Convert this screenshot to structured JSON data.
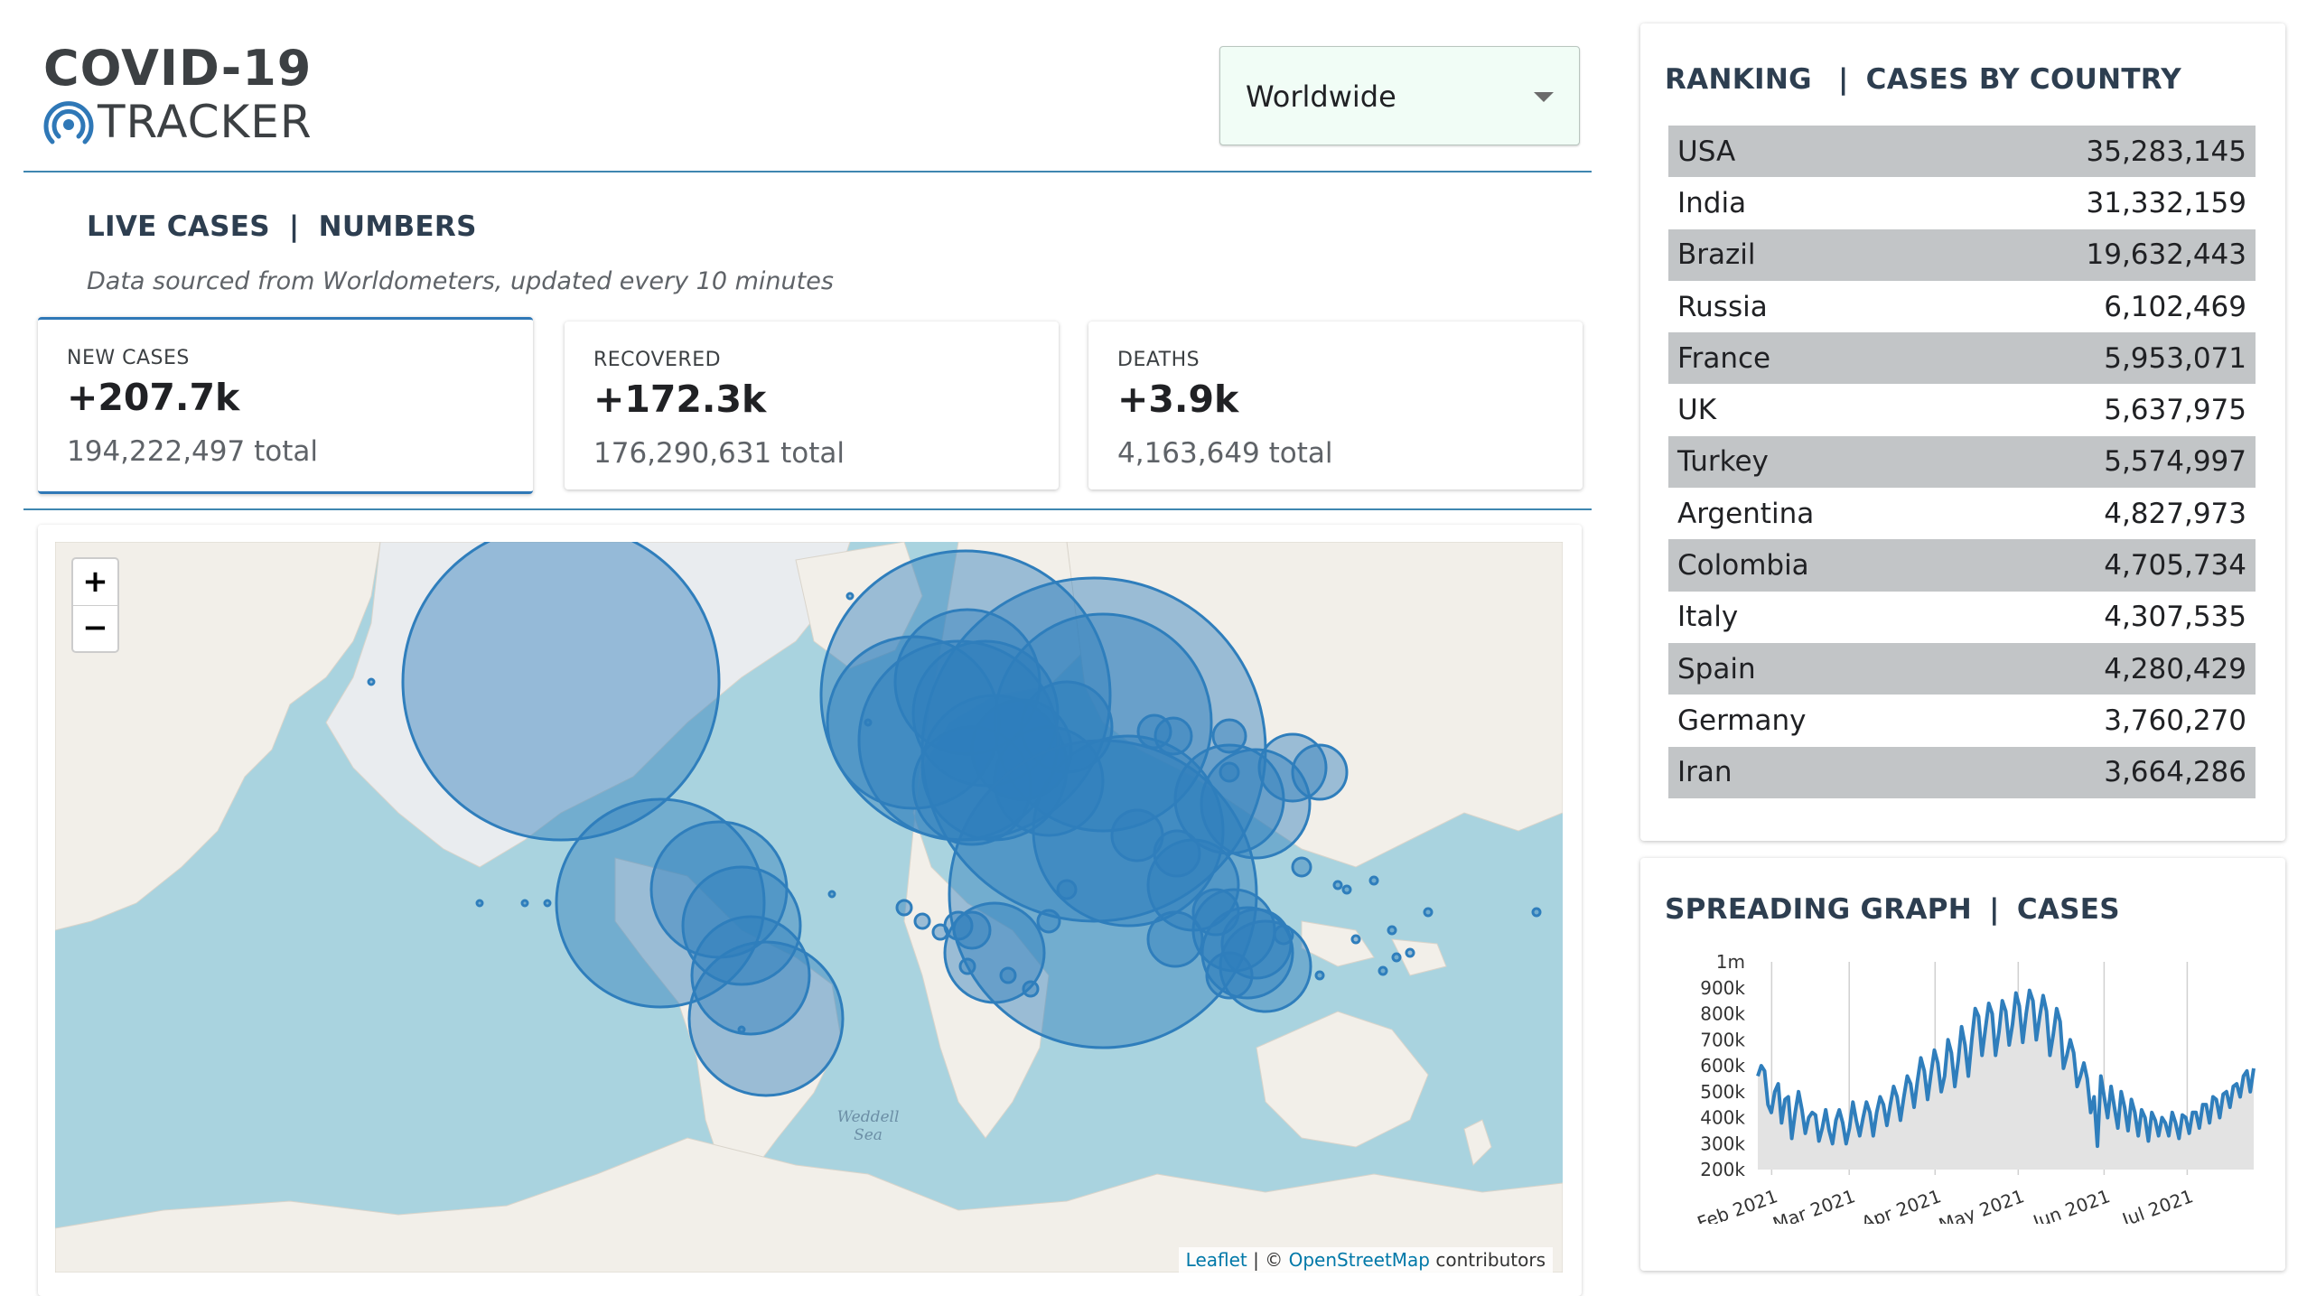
{
  "header": {
    "logo_line1": "COVID-19",
    "logo_line2": "TRACKER",
    "country_select": {
      "value": "Worldwide"
    }
  },
  "live_section": {
    "title_left": "LIVE CASES",
    "title_sep": "|",
    "title_right": "NUMBERS",
    "note": "Data sourced from Worldometers, updated every 10 minutes"
  },
  "stats": [
    {
      "label": "NEW CASES",
      "value": "+207.7k",
      "total": "194,222,497 total"
    },
    {
      "label": "RECOVERED",
      "value": "+172.3k",
      "total": "176,290,631 total"
    },
    {
      "label": "DEATHS",
      "value": "+3.9k",
      "total": "4,163,649 total"
    }
  ],
  "map": {
    "zoom_in": "+",
    "zoom_out": "−",
    "sea_label_1": "Weddell",
    "sea_label_2": "Sea",
    "attribution_leaflet": "Leaflet",
    "attribution_sep": "| ©",
    "attribution_osm": "OpenStreetMap",
    "attribution_tail": "contributors",
    "land_color": "#f2efe9",
    "water_color": "#a9d3df",
    "circle_color": "#2f7ebc"
  },
  "ranking": {
    "title_left": "RANKING",
    "title_sep": "|",
    "title_right": "CASES BY COUNTRY",
    "rows": [
      {
        "country": "USA",
        "cases": "35,283,145"
      },
      {
        "country": "India",
        "cases": "31,332,159"
      },
      {
        "country": "Brazil",
        "cases": "19,632,443"
      },
      {
        "country": "Russia",
        "cases": "6,102,469"
      },
      {
        "country": "France",
        "cases": "5,953,071"
      },
      {
        "country": "UK",
        "cases": "5,637,975"
      },
      {
        "country": "Turkey",
        "cases": "5,574,997"
      },
      {
        "country": "Argentina",
        "cases": "4,827,973"
      },
      {
        "country": "Colombia",
        "cases": "4,705,734"
      },
      {
        "country": "Italy",
        "cases": "4,307,535"
      },
      {
        "country": "Spain",
        "cases": "4,280,429"
      },
      {
        "country": "Germany",
        "cases": "3,760,270"
      },
      {
        "country": "Iran",
        "cases": "3,664,286"
      }
    ]
  },
  "graph": {
    "title_left": "SPREADING GRAPH",
    "title_sep": "|",
    "title_right": "CASES"
  },
  "chart_data": {
    "type": "area",
    "y_tick_labels": [
      "1m",
      "900k",
      "800k",
      "700k",
      "600k",
      "500k",
      "400k",
      "300k",
      "200k"
    ],
    "x_tick_labels": [
      "Feb 2021",
      "Mar 2021",
      "Apr 2021",
      "May 2021",
      "Jun 2021",
      "Jul 2021"
    ],
    "ylim": [
      200000,
      1000000
    ],
    "x_start": "2021-01-27",
    "x_end": "2021-07-25",
    "line_color": "#2f7ebc",
    "fill_color": "#e3e3e3",
    "grid": true,
    "values": [
      560000,
      600000,
      580000,
      450000,
      420000,
      500000,
      530000,
      380000,
      470000,
      480000,
      320000,
      420000,
      500000,
      430000,
      340000,
      400000,
      420000,
      410000,
      310000,
      360000,
      430000,
      350000,
      300000,
      390000,
      430000,
      380000,
      300000,
      360000,
      460000,
      390000,
      330000,
      400000,
      460000,
      420000,
      330000,
      420000,
      480000,
      450000,
      370000,
      450000,
      520000,
      480000,
      390000,
      480000,
      560000,
      530000,
      440000,
      540000,
      630000,
      580000,
      470000,
      570000,
      660000,
      610000,
      500000,
      560000,
      700000,
      650000,
      520000,
      620000,
      750000,
      680000,
      560000,
      700000,
      820000,
      790000,
      640000,
      740000,
      840000,
      800000,
      640000,
      730000,
      850000,
      810000,
      680000,
      760000,
      880000,
      830000,
      690000,
      800000,
      890000,
      850000,
      700000,
      790000,
      870000,
      810000,
      640000,
      720000,
      820000,
      770000,
      590000,
      640000,
      700000,
      650000,
      520000,
      560000,
      610000,
      550000,
      420000,
      480000,
      290000,
      560000,
      480000,
      400000,
      520000,
      440000,
      360000,
      500000,
      440000,
      350000,
      470000,
      420000,
      330000,
      430000,
      400000,
      310000,
      420000,
      390000,
      330000,
      400000,
      380000,
      330000,
      420000,
      380000,
      320000,
      410000,
      400000,
      340000,
      420000,
      420000,
      360000,
      450000,
      450000,
      380000,
      480000,
      470000,
      400000,
      490000,
      500000,
      440000,
      520000,
      530000,
      480000,
      560000,
      580000,
      500000,
      590000
    ]
  }
}
